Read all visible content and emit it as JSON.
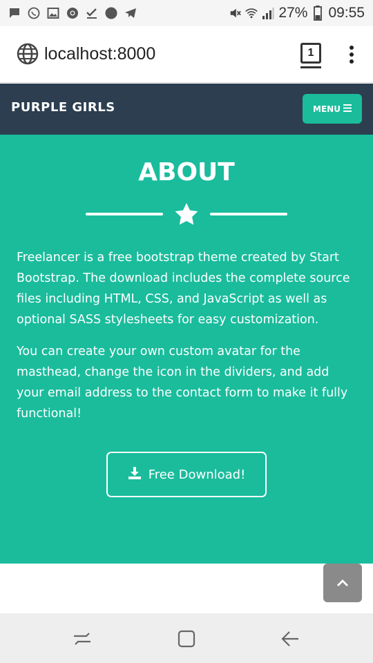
{
  "status_bar": {
    "battery_percent": "27%",
    "time": "09:55",
    "icons": [
      "chat-icon",
      "viber-icon",
      "gallery-icon",
      "chrome-icon",
      "check-icon",
      "dot-icon",
      "telegram-icon",
      "mute-icon",
      "wifi-icon",
      "signal-icon",
      "battery-icon"
    ]
  },
  "browser": {
    "url": "localhost:8000",
    "tab_count": "1",
    "icons": [
      "globe-icon",
      "tabs-icon",
      "more-icon"
    ]
  },
  "navbar": {
    "brand": "PURPLE GIRLS",
    "menu_label": "MENU",
    "menu_icon": "hamburger-icon",
    "colors": {
      "background": "#2c3e50",
      "accent": "#1abc9c"
    }
  },
  "about": {
    "title": "ABOUT",
    "divider_icon": "star-icon",
    "paragraph_1": "Freelancer is a free bootstrap theme created by Start Bootstrap. The download includes the complete source files including HTML, CSS, and JavaScript as well as optional SASS stylesheets for easy customization.",
    "paragraph_2": "You can create your own custom avatar for the masthead, change the icon in the dividers, and add your email address to the contact form to make it fully functional!",
    "download_label": "Free Download!",
    "download_icon": "download-icon",
    "background": "#1abc9c"
  },
  "scroll_top": {
    "icon": "chevron-up-icon"
  },
  "android_nav": {
    "icons": [
      "recent-apps-icon",
      "home-icon",
      "back-icon"
    ]
  }
}
